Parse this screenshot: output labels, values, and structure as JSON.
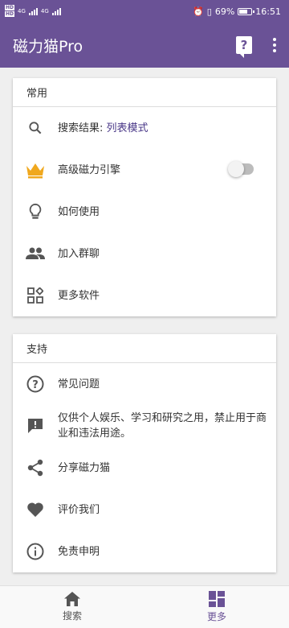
{
  "status_bar": {
    "sim1": "HD",
    "sim2": "HD",
    "net1": "4G",
    "net2": "4G",
    "battery_text": "69%",
    "time": "16:51",
    "battery_level": 0.69
  },
  "app_bar": {
    "title": "磁力猫Pro",
    "help_icon": "help-bubble-icon",
    "more_icon": "more-vert-icon"
  },
  "sections": {
    "common": {
      "title": "常用",
      "items": [
        {
          "icon": "search-icon",
          "label": "搜索结果: ",
          "value": "列表模式"
        },
        {
          "icon": "crown-icon",
          "label": "高级磁力引擎",
          "toggle": false
        },
        {
          "icon": "lightbulb-icon",
          "label": "如何使用"
        },
        {
          "icon": "group-icon",
          "label": "加入群聊"
        },
        {
          "icon": "apps-icon",
          "label": "更多软件"
        }
      ]
    },
    "support": {
      "title": "支持",
      "items": [
        {
          "icon": "question-circle-icon",
          "label": "常见问题"
        },
        {
          "icon": "feedback-icon",
          "label": "仅供个人娱乐、学习和研究之用，禁止用于商业和违法用途。"
        },
        {
          "icon": "share-icon",
          "label": "分享磁力猫"
        },
        {
          "icon": "heart-icon",
          "label": "评价我们"
        },
        {
          "icon": "info-icon",
          "label": "免责申明"
        }
      ]
    }
  },
  "bottom_nav": {
    "items": [
      {
        "icon": "home-icon",
        "label": "搜索",
        "active": false
      },
      {
        "icon": "dashboard-icon",
        "label": "更多",
        "active": true
      }
    ]
  },
  "colors": {
    "primary": "#6a5296",
    "crown": "#f0a81e",
    "icon": "#555555"
  }
}
